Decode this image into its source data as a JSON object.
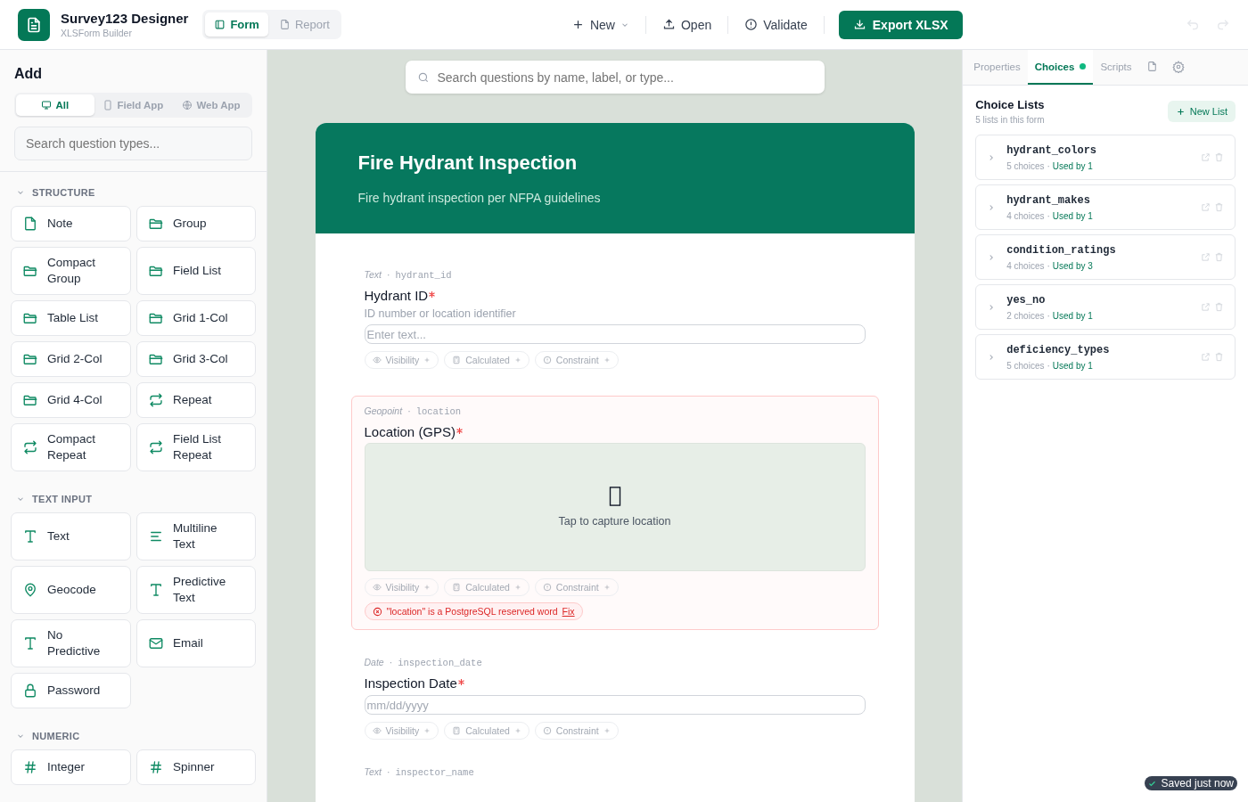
{
  "app": {
    "title": "Survey123 Designer",
    "subtitle": "XLSForm Builder"
  },
  "view_tabs": [
    {
      "label": "Form",
      "kind": "form",
      "selected": true
    },
    {
      "label": "Report",
      "kind": "report",
      "selected": false
    }
  ],
  "toolbar": [
    {
      "label": "New",
      "kind": "new"
    },
    {
      "label": "Open",
      "kind": "open"
    },
    {
      "label": "Validate",
      "kind": "validate"
    }
  ],
  "export_button": "Export XLSX",
  "history": [
    {
      "kind": "undo",
      "disabled": true
    },
    {
      "kind": "redo",
      "disabled": true
    }
  ],
  "sidebar": {
    "title": "Add",
    "platforms": [
      {
        "label": "All",
        "kind": "all",
        "selected": true
      },
      {
        "label": "Field App",
        "kind": "field",
        "selected": false
      },
      {
        "label": "Web App",
        "kind": "web",
        "selected": false
      }
    ],
    "search": {
      "placeholder": "Search question types..."
    },
    "sections": [
      {
        "title": "STRUCTURE",
        "expanded": true,
        "items": [
          {
            "label": "Note",
            "kind": "note"
          },
          {
            "label": "Group",
            "kind": "group"
          },
          {
            "label": "Compact Group",
            "kind": "group"
          },
          {
            "label": "Field List",
            "kind": "group"
          },
          {
            "label": "Table List",
            "kind": "group"
          },
          {
            "label": "Grid 1-Col",
            "kind": "group"
          },
          {
            "label": "Grid 2-Col",
            "kind": "group"
          },
          {
            "label": "Grid 3-Col",
            "kind": "group"
          },
          {
            "label": "Grid 4-Col",
            "kind": "group"
          },
          {
            "label": "Repeat",
            "kind": "repeat"
          },
          {
            "label": "Compact Repeat",
            "kind": "repeat"
          },
          {
            "label": "Field List Repeat",
            "kind": "repeat"
          }
        ]
      },
      {
        "title": "TEXT INPUT",
        "expanded": true,
        "items": [
          {
            "label": "Text",
            "kind": "text"
          },
          {
            "label": "Multiline Text",
            "kind": "multiline"
          },
          {
            "label": "Geocode",
            "kind": "geocode"
          },
          {
            "label": "Predictive Text",
            "kind": "text"
          },
          {
            "label": "No Predictive",
            "kind": "text"
          },
          {
            "label": "Email",
            "kind": "email"
          },
          {
            "label": "Password",
            "kind": "password"
          }
        ]
      },
      {
        "title": "NUMERIC",
        "expanded": true,
        "items": [
          {
            "label": "Integer",
            "kind": "number"
          },
          {
            "label": "Spinner",
            "kind": "number"
          }
        ]
      }
    ]
  },
  "canvas": {
    "search": {
      "placeholder": "Search questions by name, label, or type..."
    },
    "form": {
      "title": "Fire Hydrant Inspection",
      "description": "Fire hydrant inspection per NFPA guidelines",
      "questions": [
        {
          "kind": "text",
          "type": "Text",
          "separator": "·",
          "name": "hydrant_id",
          "label": "Hydrant ID",
          "required": true,
          "hint": "ID number or location identifier",
          "placeholder": "Enter text...",
          "chips": [
            "Visibility",
            "Calculated",
            "Constraint"
          ]
        },
        {
          "kind": "geopoint",
          "type": "Geopoint",
          "separator": "·",
          "name": "location",
          "label": "Location (GPS)",
          "required": true,
          "prompt": "Tap to capture location",
          "chips": [
            "Visibility",
            "Calculated",
            "Constraint"
          ],
          "error": {
            "message": "\"location\" is a PostgreSQL reserved word",
            "action": "Fix"
          }
        },
        {
          "kind": "date",
          "type": "Date",
          "separator": "·",
          "name": "inspection_date",
          "label": "Inspection Date",
          "required": true,
          "placeholder": "mm/dd/yyyy",
          "chips": [
            "Visibility",
            "Calculated",
            "Constraint"
          ]
        },
        {
          "kind": "partial",
          "type": "Text",
          "separator": "·",
          "name": "inspector_name"
        }
      ]
    }
  },
  "panel": {
    "tabs": [
      {
        "label": "Properties",
        "kind": "text",
        "selected": false,
        "dot": false
      },
      {
        "label": "Choices",
        "kind": "text",
        "selected": true,
        "dot": true
      },
      {
        "label": "Scripts",
        "kind": "text",
        "selected": false,
        "dot": false
      },
      {
        "kind": "document",
        "selected": false,
        "dot": false
      },
      {
        "kind": "settings",
        "selected": false,
        "dot": false
      }
    ],
    "title": "Choice Lists",
    "subtitle": "5 lists in this form",
    "new_button": "New List",
    "lists": [
      {
        "name": "hydrant_colors",
        "count": "5 choices",
        "separator": "·",
        "usage": "Used by 1"
      },
      {
        "name": "hydrant_makes",
        "count": "4 choices",
        "separator": "·",
        "usage": "Used by 1"
      },
      {
        "name": "condition_ratings",
        "count": "4 choices",
        "separator": "·",
        "usage": "Used by 3"
      },
      {
        "name": "yes_no",
        "count": "2 choices",
        "separator": "·",
        "usage": "Used by 1"
      },
      {
        "name": "deficiency_types",
        "count": "5 choices",
        "separator": "·",
        "usage": "Used by 1"
      }
    ]
  },
  "toast": "Saved just now"
}
